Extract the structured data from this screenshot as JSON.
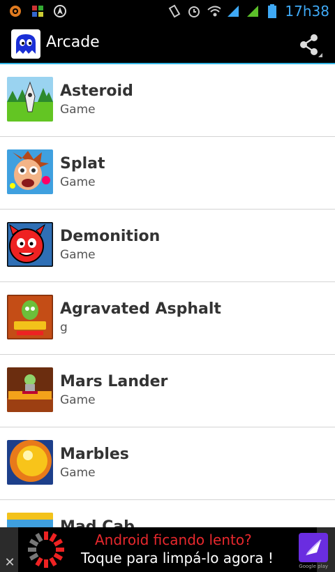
{
  "statusbar": {
    "time": "17h38",
    "icons": [
      "notification-icon",
      "photo-icon",
      "navigation-icon",
      "vibrate-icon",
      "alarm-icon",
      "wifi-icon",
      "signal-icon",
      "signal-2-icon",
      "battery-icon"
    ]
  },
  "actionbar": {
    "title": "Arcade",
    "share_icon": "share-icon"
  },
  "games": [
    {
      "title": "Asteroid",
      "subtitle": "Game"
    },
    {
      "title": "Splat",
      "subtitle": "Game"
    },
    {
      "title": "Demonition",
      "subtitle": "Game"
    },
    {
      "title": "Agravated Asphalt",
      "subtitle": "g"
    },
    {
      "title": "Mars Lander",
      "subtitle": "Game"
    },
    {
      "title": "Marbles",
      "subtitle": "Game"
    },
    {
      "title": "Mad Cab",
      "subtitle": ""
    }
  ],
  "ad": {
    "line1": "Android ficando lento?",
    "line2": "Toque para limpá-lo agora !",
    "play_text": "Google play"
  },
  "colors": {
    "accent": "#33b5e5",
    "time": "#3fa9f5",
    "ad_red": "#e8282d"
  }
}
